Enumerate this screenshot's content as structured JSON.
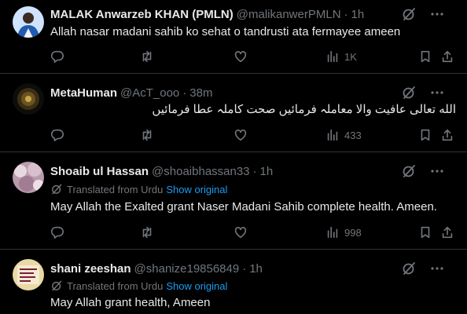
{
  "tweets": [
    {
      "name": "MALAK Anwarzeb KHAN (PMLN)",
      "handle": "@malikanwerPMLN",
      "time": "1h",
      "text": "Allah nasar madani sahib ko sehat o tandrusti ata fermayee ameen",
      "views": "1K"
    },
    {
      "name": "MetaHuman",
      "handle": "@AcT_ooo",
      "time": "38m",
      "text": "الله تعالی عافیت والا معاملہ فرمائیں صحت کاملہ عطا فرمائیں",
      "views": "433"
    },
    {
      "name": "Shoaib ul Hassan",
      "handle": "@shoaibhassan33",
      "time": "1h",
      "translated_label": "Translated from Urdu",
      "show_original": "Show original",
      "text": "May Allah the Exalted grant Naser Madani Sahib complete health. Ameen.",
      "views": "998"
    },
    {
      "name": "shani zeeshan",
      "handle": "@shanize19856849",
      "time": "1h",
      "translated_label": "Translated from Urdu",
      "show_original": "Show original",
      "text": "May Allah grant health, Ameen"
    }
  ],
  "separator": "·",
  "icons": {
    "grok": "grok-icon",
    "more": "more-icon",
    "reply": "reply-icon",
    "retweet": "retweet-icon",
    "like": "like-icon",
    "views": "views-icon",
    "bookmark": "bookmark-icon",
    "share": "share-icon",
    "translate": "translate-icon"
  },
  "colors": {
    "background": "#000000",
    "text": "#e7e9ea",
    "muted": "#71767b",
    "link": "#1d9bf0",
    "divider": "#2f3336"
  }
}
